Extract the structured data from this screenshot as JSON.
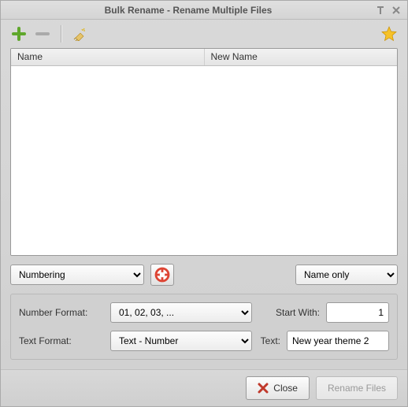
{
  "window": {
    "title": "Bulk Rename - Rename Multiple Files"
  },
  "table": {
    "col_name": "Name",
    "col_newname": "New Name"
  },
  "mode": {
    "left": "Numbering",
    "right": "Name only"
  },
  "options": {
    "number_format_label": "Number Format:",
    "number_format_value": "01, 02, 03, ...",
    "start_with_label": "Start With:",
    "start_with_value": "1",
    "text_format_label": "Text Format:",
    "text_format_value": "Text - Number",
    "text_label": "Text:",
    "text_value": "New year theme 2"
  },
  "footer": {
    "close": "Close",
    "rename": "Rename Files"
  }
}
